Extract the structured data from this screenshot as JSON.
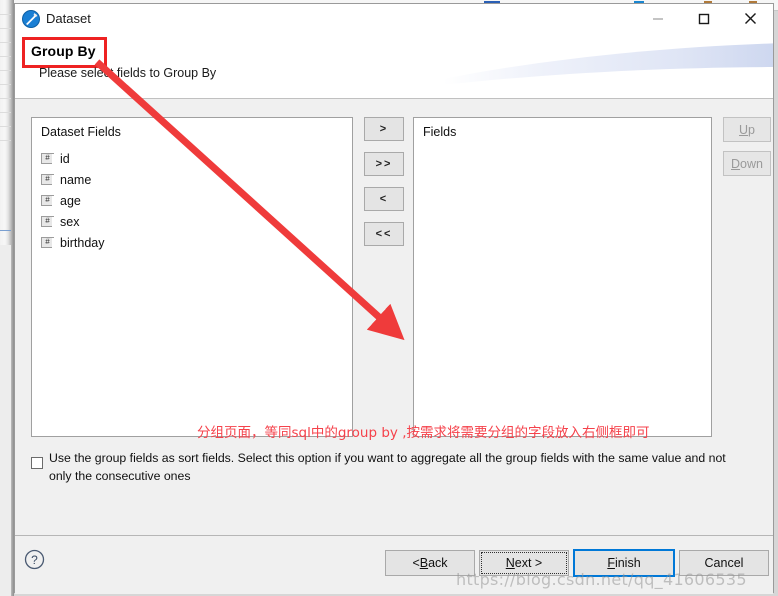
{
  "window": {
    "title": "Dataset",
    "app_icon": "dataset-icon",
    "controls": {
      "minimize": "minimize-icon",
      "maximize": "maximize-icon",
      "close": "close-icon"
    }
  },
  "header": {
    "heading": "Group By",
    "description": "Please select fields to Group By",
    "highlight_color": "#ee2222"
  },
  "left_panel": {
    "title": "Dataset Fields",
    "fields": [
      {
        "icon": "#",
        "label": "id"
      },
      {
        "icon": "#",
        "label": "name"
      },
      {
        "icon": "#",
        "label": "age"
      },
      {
        "icon": "#",
        "label": "sex"
      },
      {
        "icon": "#",
        "label": "birthday"
      }
    ]
  },
  "transfer_buttons": [
    {
      "name": "move-right",
      "label": ">"
    },
    {
      "name": "move-all-right",
      "label": ">>"
    },
    {
      "name": "move-left",
      "label": "<"
    },
    {
      "name": "move-all-left",
      "label": "<<"
    }
  ],
  "right_panel": {
    "title": "Fields",
    "fields": []
  },
  "order_buttons": [
    {
      "name": "up",
      "mnemonic": "U",
      "rest": "p",
      "enabled": false
    },
    {
      "name": "down",
      "mnemonic": "D",
      "rest": "own",
      "enabled": false
    }
  ],
  "checkbox": {
    "checked": false,
    "label": "Use the group fields as sort fields. Select this option if you want to aggregate all the group fields with the same value and not only the consecutive ones"
  },
  "annotation": {
    "text": "分组页面，等同sql中的group by ,按需求将需要分组的字段放入右侧框即可",
    "color": "#f5424b"
  },
  "footer": {
    "help": "?",
    "buttons": [
      {
        "name": "back",
        "pre": "< ",
        "mnemonic": "B",
        "post": "ack",
        "focused": false,
        "default": false
      },
      {
        "name": "next",
        "pre": "",
        "mnemonic": "N",
        "post": "ext >",
        "focused": true,
        "default": false
      },
      {
        "name": "finish",
        "pre": "",
        "mnemonic": "F",
        "post": "inish",
        "focused": false,
        "default": true
      },
      {
        "name": "cancel",
        "pre": "",
        "mnemonic": "",
        "post": "Cancel",
        "focused": false,
        "default": false
      }
    ],
    "default_button_color": "#0078d7"
  },
  "watermark": "https://blog.csdn.net/qq_41606535"
}
